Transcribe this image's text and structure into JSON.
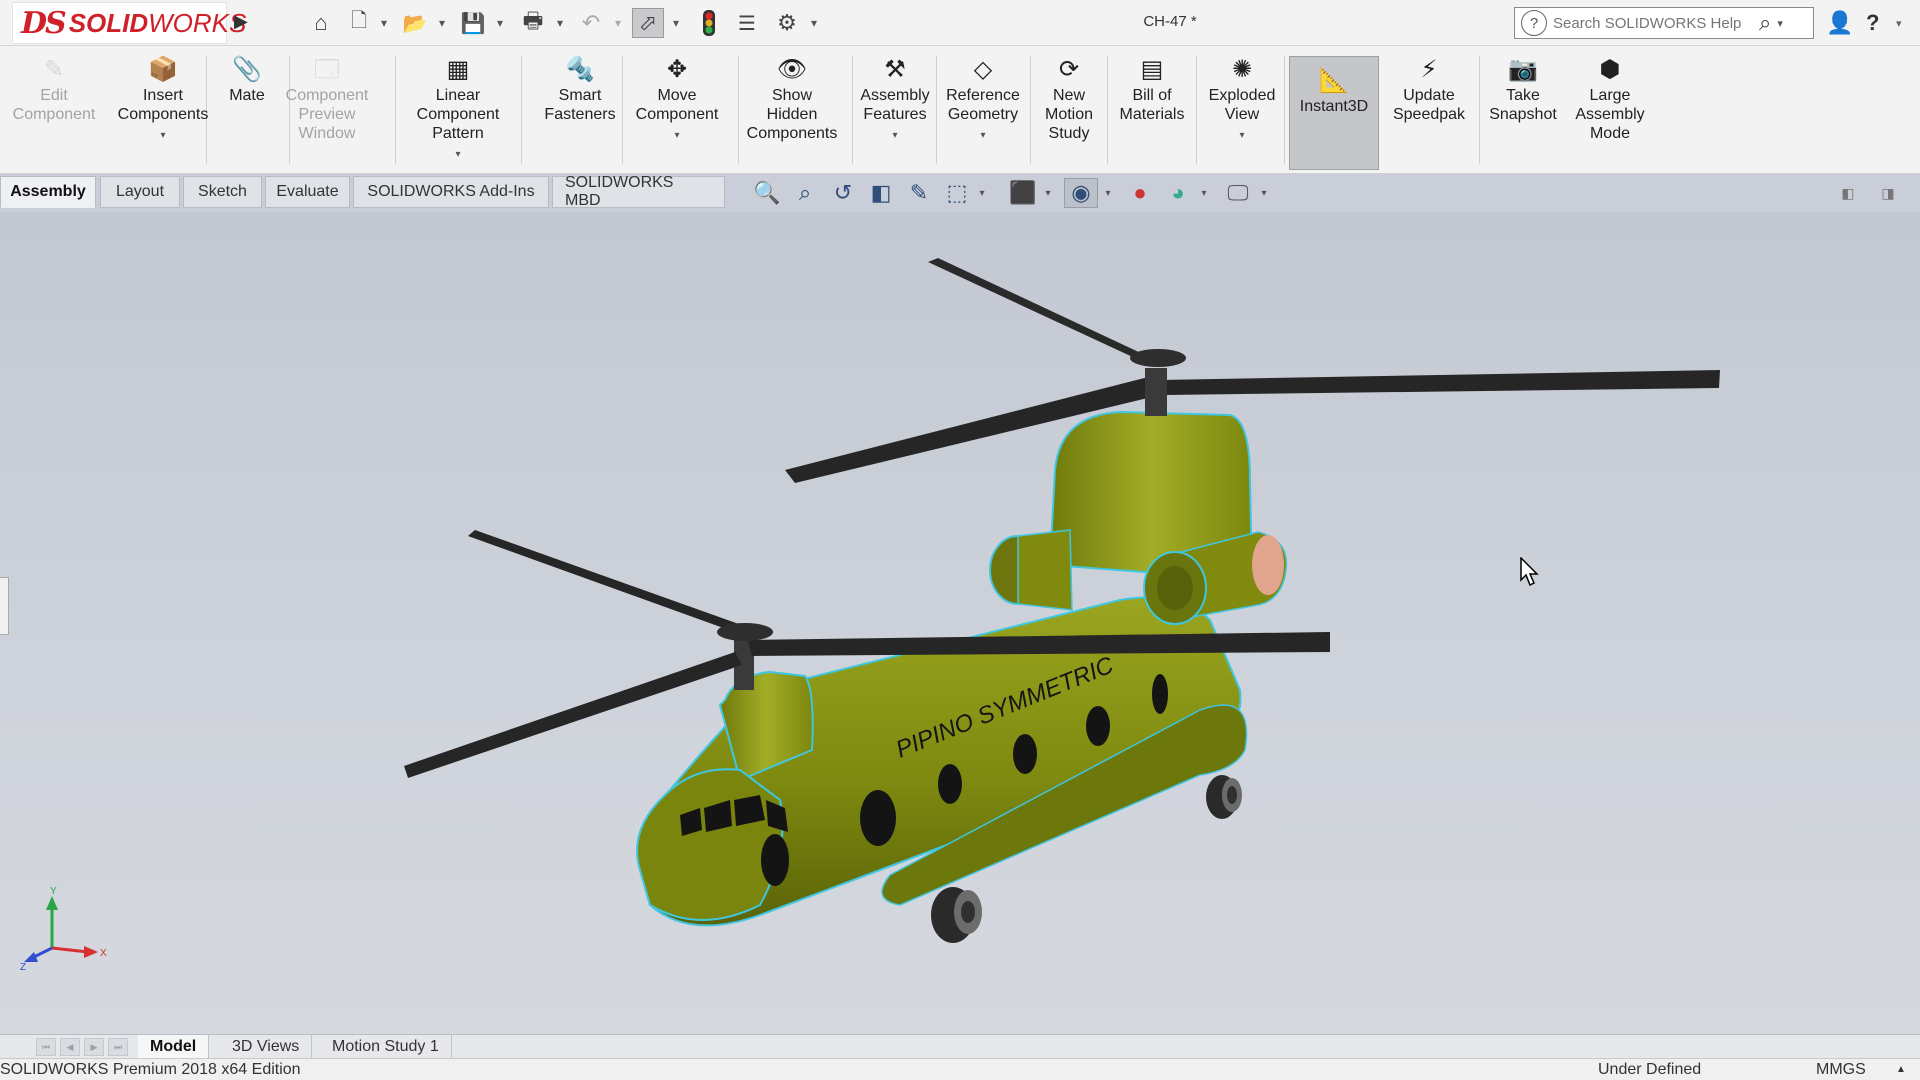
{
  "app": {
    "logo_text_ds": "DS",
    "logo_text_brand_bold": "SOLID",
    "logo_text_brand_light": "WORKS",
    "document_title": "CH-47 *"
  },
  "quick_access": [
    {
      "name": "home-icon",
      "glyph": "⌂"
    },
    {
      "name": "new-document-icon",
      "glyph": "🗋"
    },
    {
      "name": "open-icon",
      "glyph": "📂"
    },
    {
      "name": "save-icon",
      "glyph": "💾"
    },
    {
      "name": "print-icon",
      "glyph": "🖶"
    },
    {
      "name": "undo-icon",
      "glyph": "↶"
    },
    {
      "name": "select-icon",
      "glyph": "⬀"
    },
    {
      "name": "rebuild-icon",
      "glyph": "🚦"
    },
    {
      "name": "file-properties-icon",
      "glyph": "☰"
    },
    {
      "name": "options-icon",
      "glyph": "⚙"
    }
  ],
  "help_search": {
    "placeholder": "Search SOLIDWORKS Help"
  },
  "commands": [
    {
      "label": "Edit\nComponent",
      "icon": "edit-component-icon",
      "glyph": "✎",
      "disabled": true
    },
    {
      "label": "Insert\nComponents",
      "icon": "insert-components-icon",
      "glyph": "📦",
      "caret": true
    },
    {
      "label": "Mate",
      "icon": "mate-icon",
      "glyph": "📎"
    },
    {
      "label": "Component\nPreview\nWindow",
      "icon": "component-preview-window-icon",
      "glyph": "🗔",
      "disabled": true
    },
    {
      "label": "Linear Component\nPattern",
      "icon": "linear-component-pattern-icon",
      "glyph": "▦",
      "caret": true
    },
    {
      "label": "Smart\nFasteners",
      "icon": "smart-fasteners-icon",
      "glyph": "🔩"
    },
    {
      "label": "Move\nComponent",
      "icon": "move-component-icon",
      "glyph": "✥",
      "caret": true
    },
    {
      "label": "Show\nHidden\nComponents",
      "icon": "show-hidden-components-icon",
      "glyph": "👁"
    },
    {
      "label": "Assembly\nFeatures",
      "icon": "assembly-features-icon",
      "glyph": "⚒",
      "caret": true
    },
    {
      "label": "Reference\nGeometry",
      "icon": "reference-geometry-icon",
      "glyph": "◇",
      "caret": true
    },
    {
      "label": "New\nMotion\nStudy",
      "icon": "new-motion-study-icon",
      "glyph": "⟳"
    },
    {
      "label": "Bill of\nMaterials",
      "icon": "bill-of-materials-icon",
      "glyph": "▤"
    },
    {
      "label": "Exploded\nView",
      "icon": "exploded-view-icon",
      "glyph": "✺",
      "caret": true
    },
    {
      "label": "Instant3D",
      "icon": "instant3d-icon",
      "glyph": "📐",
      "active": true
    },
    {
      "label": "Update\nSpeedpak",
      "icon": "update-speedpak-icon",
      "glyph": "⚡"
    },
    {
      "label": "Take\nSnapshot",
      "icon": "take-snapshot-icon",
      "glyph": "📷"
    },
    {
      "label": "Large\nAssembly\nMode",
      "icon": "large-assembly-mode-icon",
      "glyph": "⬢"
    }
  ],
  "tabs": [
    "Assembly",
    "Layout",
    "Sketch",
    "Evaluate",
    "SOLIDWORKS Add-Ins",
    "SOLIDWORKS MBD"
  ],
  "active_tab": "Assembly",
  "model": {
    "fuselage_text": "PIPINO SYMMETRIC",
    "body_color": "#7f8a0e",
    "edge_color": "#3fc6e0",
    "exhaust_color": "#e0a58c",
    "triad_x": "X",
    "triad_y": "Y",
    "triad_z": "Z"
  },
  "bottom_tabs": [
    "Model",
    "3D Views",
    "Motion Study 1"
  ],
  "active_bottom_tab": "Model",
  "status": {
    "edition": "SOLIDWORKS Premium 2018 x64 Edition",
    "definition": "Under Defined",
    "units": "MMGS",
    "caret": "▲"
  }
}
